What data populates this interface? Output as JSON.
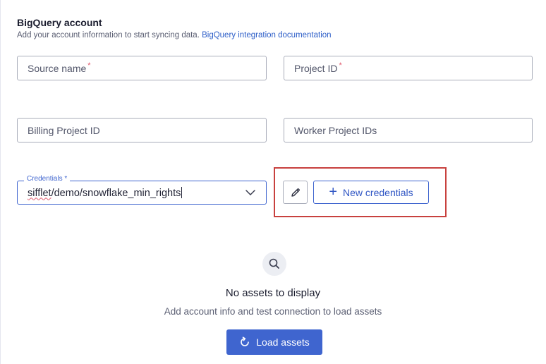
{
  "section": {
    "title": "BigQuery account",
    "subtitle": "Add your account information to start syncing data.",
    "doc_link": "BigQuery integration documentation"
  },
  "fields": {
    "source_name": {
      "placeholder": "Source name",
      "required": "*"
    },
    "project_id": {
      "placeholder": "Project ID",
      "required": "*"
    },
    "billing_project_id": {
      "placeholder": "Billing Project ID"
    },
    "worker_project_ids": {
      "placeholder": "Worker Project IDs"
    }
  },
  "credentials": {
    "label": "Credentials",
    "required": "*",
    "value_misspelled": "sifflet",
    "value_rest": "/demo/snowflake_min_rights",
    "new_button": "New credentials",
    "plus_symbol": "+"
  },
  "empty_state": {
    "title": "No assets to display",
    "subtitle": "Add account info and test connection to load assets",
    "load_button": "Load assets"
  },
  "colors": {
    "accent": "#3f65cf",
    "highlight": "#c8413e",
    "required": "#e0566b"
  },
  "icons": [
    "search-icon",
    "pencil-icon",
    "plus-icon",
    "chevron-down-icon",
    "refresh-icon"
  ]
}
